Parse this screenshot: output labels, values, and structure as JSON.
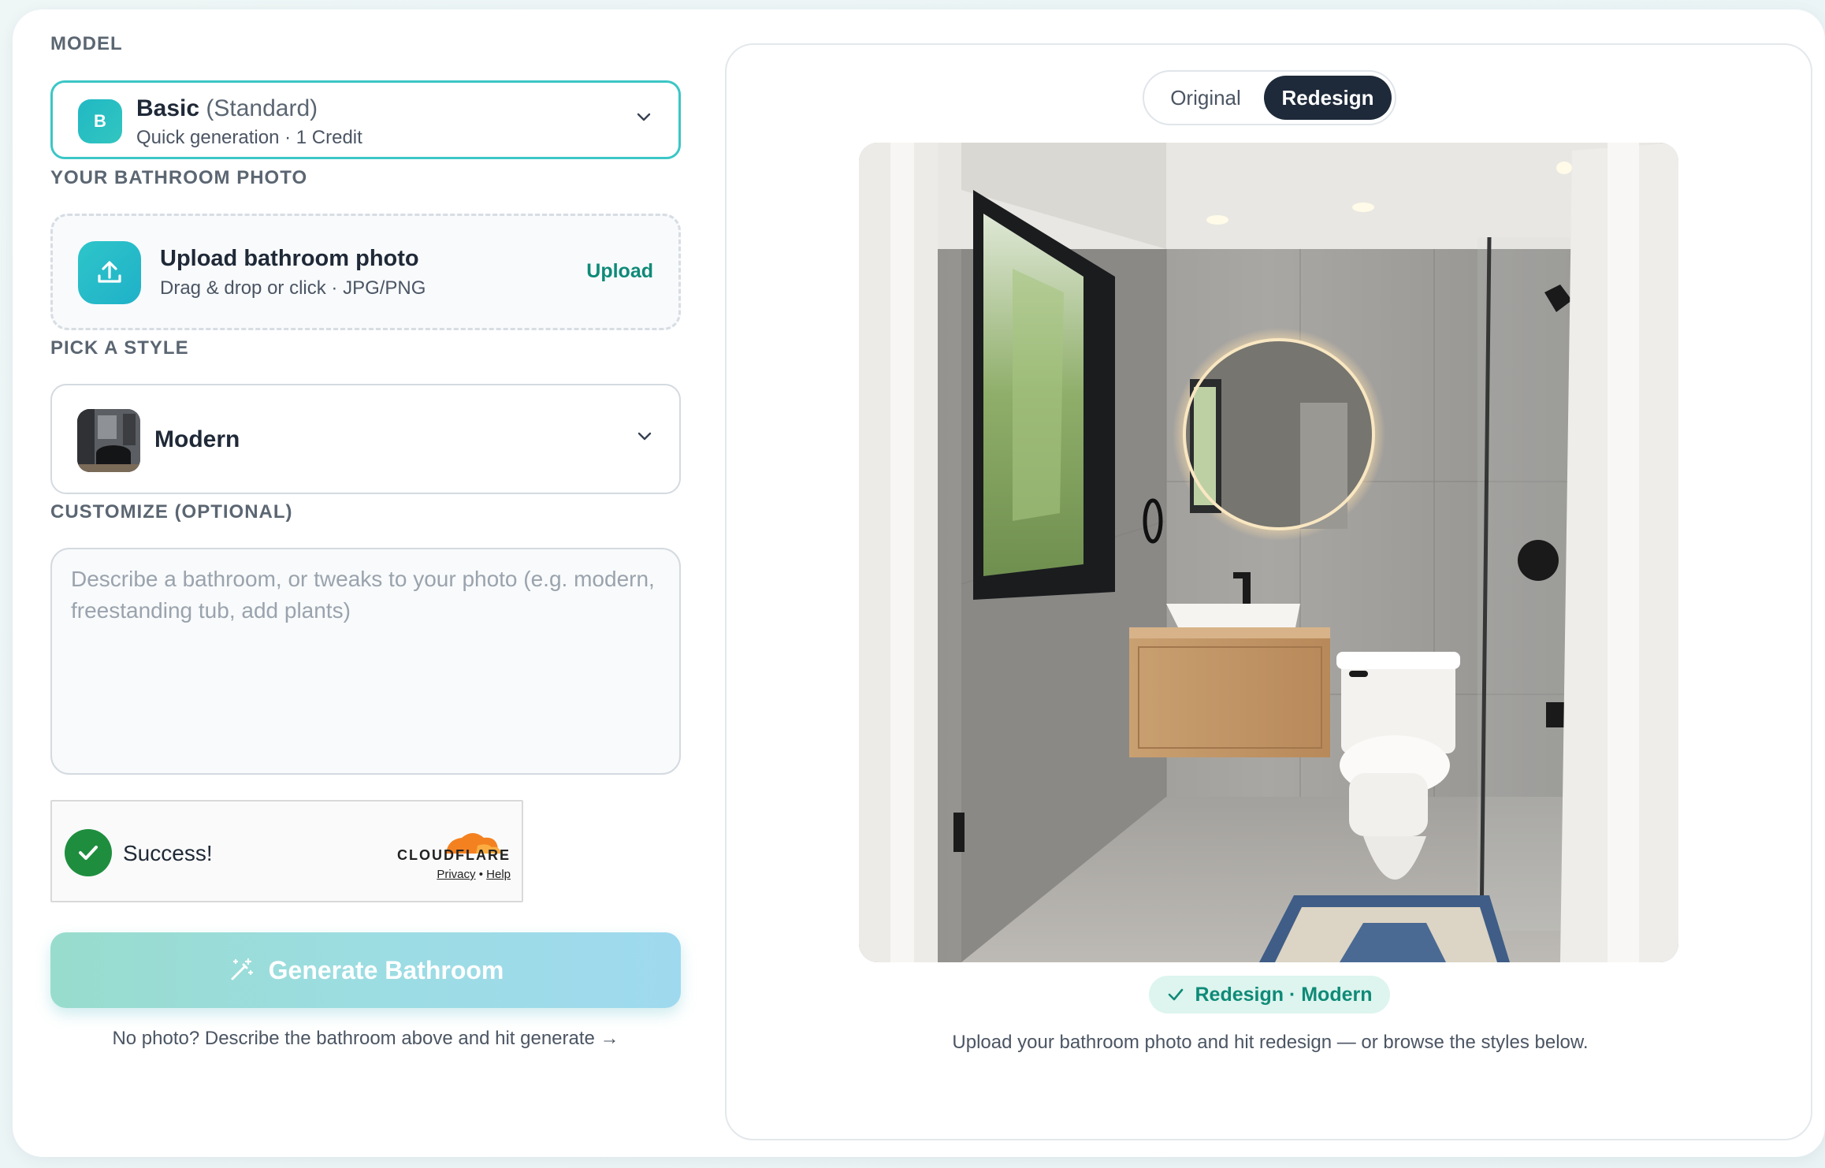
{
  "model": {
    "section_label": "MODEL",
    "avatar_letter": "B",
    "name": "Basic",
    "tier": "(Standard)",
    "description": "Quick generation · 1 Credit"
  },
  "photo": {
    "section_label": "YOUR BATHROOM PHOTO",
    "title": "Upload bathroom photo",
    "subtitle": "Drag & drop or click · JPG/PNG",
    "action": "Upload"
  },
  "style": {
    "section_label": "PICK A STYLE",
    "selected": "Modern"
  },
  "customize": {
    "section_label": "CUSTOMIZE (OPTIONAL)",
    "placeholder": "Describe a bathroom, or tweaks to your photo (e.g. modern, freestanding tub, add plants)",
    "value": ""
  },
  "captcha": {
    "status": "Success!",
    "brand": "CLOUDFLARE",
    "privacy": "Privacy",
    "separator": "•",
    "help": "Help"
  },
  "generate": {
    "label": "Generate Bathroom",
    "hint": "No photo? Describe the bathroom above and hit generate →"
  },
  "preview": {
    "tabs": [
      "Original",
      "Redesign"
    ],
    "active_tab": "Redesign",
    "badge": "Redesign · Modern",
    "caption": "Upload your bathroom photo and hit redesign — or browse the styles below."
  },
  "colors": {
    "accent": "#3cc6c6",
    "brand_green": "#0f8a78",
    "dark_toggle": "#1e2a3a",
    "success": "#1e8e3e",
    "cloudflare_orange": "#f48120"
  }
}
